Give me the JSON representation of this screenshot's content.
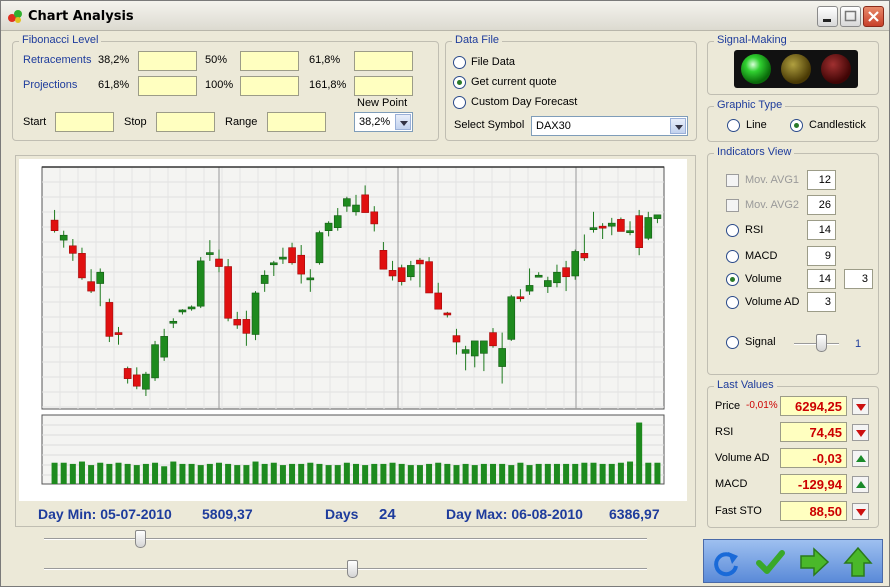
{
  "window": {
    "title": "Chart Analysis"
  },
  "fibonacci": {
    "legend": "Fibonacci Level",
    "retracements_label": "Retracements",
    "retracements": [
      "38,2%",
      "50%",
      "61,8%"
    ],
    "projections_label": "Projections",
    "projections": [
      "61,8%",
      "100%",
      "161,8%"
    ],
    "new_point_label": "New Point",
    "new_point_value": "38,2%",
    "start_label": "Start",
    "stop_label": "Stop",
    "range_label": "Range"
  },
  "datafile": {
    "legend": "Data File",
    "options": [
      "File Data",
      "Get current quote",
      "Custom Day Forecast"
    ],
    "selected": 1,
    "symbol_label": "Select Symbol",
    "symbol_value": "DAX30"
  },
  "signal_making": {
    "legend": "Signal-Making",
    "lights": [
      "#2ec82e",
      "#8a7a10",
      "#7a1010"
    ]
  },
  "graphic_type": {
    "legend": "Graphic Type",
    "options": [
      "Line",
      "Candlestick"
    ],
    "selected": 1
  },
  "indicators": {
    "legend": "Indicators View",
    "mov_avg1_label": "Mov. AVG1",
    "mov_avg1_value": "12",
    "mov_avg2_label": "Mov. AVG2",
    "mov_avg2_value": "26",
    "rsi_label": "RSI",
    "rsi_value": "14",
    "macd_label": "MACD",
    "macd_value": "9",
    "volume_label": "Volume",
    "volume_value": "14",
    "volume_value2": "3",
    "volume_ad_label": "Volume AD",
    "volume_ad_value": "3",
    "signal_label": "Signal",
    "signal_value": "1",
    "signal_level": 0.6
  },
  "last_values": {
    "legend": "Last Values",
    "price_label": "Price",
    "price_change": "-0,01%",
    "price_value": "6294,25",
    "rsi_label": "RSI",
    "rsi_value": "74,45",
    "volume_ad_label": "Volume AD",
    "volume_ad_value": "-0,03",
    "macd_label": "MACD",
    "macd_value": "-129,94",
    "fast_sto_label": "Fast STO",
    "fast_sto_value": "88,50"
  },
  "chart_info": {
    "day_min_label": "Day Min: 05-07-2010",
    "day_min_value": "5809,37",
    "days_label": "Days",
    "days_value": "24",
    "day_max_label": "Day Max: 06-08-2010",
    "day_max_value": "6386,97"
  },
  "sliders": {
    "top_level": 0.16,
    "bottom_level": 0.51
  },
  "chart_data": {
    "type": "candlestick",
    "ylim": [
      5809.37,
      6386.97
    ],
    "grid": true,
    "up_color": "#1e8a1e",
    "down_color": "#e01010",
    "candles": [
      {
        "o": 6278,
        "h": 6305,
        "l": 6245,
        "c": 6250
      },
      {
        "o": 6225,
        "h": 6250,
        "l": 6205,
        "c": 6238
      },
      {
        "o": 6210,
        "h": 6228,
        "l": 6170,
        "c": 6190
      },
      {
        "o": 6190,
        "h": 6205,
        "l": 6120,
        "c": 6125
      },
      {
        "o": 6115,
        "h": 6148,
        "l": 6085,
        "c": 6090
      },
      {
        "o": 6110,
        "h": 6150,
        "l": 6050,
        "c": 6140
      },
      {
        "o": 6060,
        "h": 6070,
        "l": 5955,
        "c": 5970
      },
      {
        "o": 5980,
        "h": 5995,
        "l": 5948,
        "c": 5978
      },
      {
        "o": 5885,
        "h": 5890,
        "l": 5845,
        "c": 5858
      },
      {
        "o": 5868,
        "h": 5888,
        "l": 5830,
        "c": 5838
      },
      {
        "o": 5830,
        "h": 5876,
        "l": 5812,
        "c": 5870
      },
      {
        "o": 5860,
        "h": 5958,
        "l": 5852,
        "c": 5948
      },
      {
        "o": 5915,
        "h": 5990,
        "l": 5905,
        "c": 5970
      },
      {
        "o": 6005,
        "h": 6018,
        "l": 5992,
        "c": 6010
      },
      {
        "o": 6040,
        "h": 6042,
        "l": 6028,
        "c": 6040
      },
      {
        "o": 6045,
        "h": 6052,
        "l": 6038,
        "c": 6048
      },
      {
        "o": 6050,
        "h": 6180,
        "l": 6045,
        "c": 6170
      },
      {
        "o": 6190,
        "h": 6225,
        "l": 6170,
        "c": 6192
      },
      {
        "o": 6175,
        "h": 6200,
        "l": 6140,
        "c": 6155
      },
      {
        "o": 6155,
        "h": 6175,
        "l": 6010,
        "c": 6018
      },
      {
        "o": 6015,
        "h": 6035,
        "l": 5990,
        "c": 6000
      },
      {
        "o": 6015,
        "h": 6038,
        "l": 5945,
        "c": 5978
      },
      {
        "o": 5975,
        "h": 6090,
        "l": 5960,
        "c": 6085
      },
      {
        "o": 6110,
        "h": 6145,
        "l": 6088,
        "c": 6132
      },
      {
        "o": 6160,
        "h": 6170,
        "l": 6130,
        "c": 6165
      },
      {
        "o": 6180,
        "h": 6205,
        "l": 6162,
        "c": 6180
      },
      {
        "o": 6205,
        "h": 6218,
        "l": 6160,
        "c": 6165
      },
      {
        "o": 6185,
        "h": 6212,
        "l": 6110,
        "c": 6135
      },
      {
        "o": 6120,
        "h": 6148,
        "l": 6088,
        "c": 6125
      },
      {
        "o": 6165,
        "h": 6250,
        "l": 6160,
        "c": 6245
      },
      {
        "o": 6250,
        "h": 6275,
        "l": 6235,
        "c": 6270
      },
      {
        "o": 6258,
        "h": 6310,
        "l": 6250,
        "c": 6290
      },
      {
        "o": 6315,
        "h": 6340,
        "l": 6300,
        "c": 6335
      },
      {
        "o": 6300,
        "h": 6345,
        "l": 6290,
        "c": 6318
      },
      {
        "o": 6345,
        "h": 6370,
        "l": 6300,
        "c": 6298
      },
      {
        "o": 6300,
        "h": 6315,
        "l": 6248,
        "c": 6268
      },
      {
        "o": 6198,
        "h": 6220,
        "l": 6150,
        "c": 6148
      },
      {
        "o": 6145,
        "h": 6170,
        "l": 6118,
        "c": 6130
      },
      {
        "o": 6152,
        "h": 6160,
        "l": 6105,
        "c": 6115
      },
      {
        "o": 6128,
        "h": 6170,
        "l": 6118,
        "c": 6158
      },
      {
        "o": 6172,
        "h": 6178,
        "l": 6100,
        "c": 6162
      },
      {
        "o": 6168,
        "h": 6180,
        "l": 6085,
        "c": 6085
      },
      {
        "o": 6085,
        "h": 6112,
        "l": 6058,
        "c": 6042
      },
      {
        "o": 6032,
        "h": 6035,
        "l": 6020,
        "c": 6030
      },
      {
        "o": 5972,
        "h": 5990,
        "l": 5922,
        "c": 5955
      },
      {
        "o": 5925,
        "h": 5945,
        "l": 5880,
        "c": 5935
      },
      {
        "o": 5918,
        "h": 5950,
        "l": 5888,
        "c": 5958
      },
      {
        "o": 5925,
        "h": 5935,
        "l": 5878,
        "c": 5958
      },
      {
        "o": 5980,
        "h": 5992,
        "l": 5940,
        "c": 5945
      },
      {
        "o": 5890,
        "h": 5980,
        "l": 5845,
        "c": 5938
      },
      {
        "o": 5962,
        "h": 6080,
        "l": 5958,
        "c": 6075
      },
      {
        "o": 6075,
        "h": 6095,
        "l": 6062,
        "c": 6070
      },
      {
        "o": 6090,
        "h": 6150,
        "l": 6080,
        "c": 6105
      },
      {
        "o": 6132,
        "h": 6140,
        "l": 6130,
        "c": 6132
      },
      {
        "o": 6102,
        "h": 6128,
        "l": 6085,
        "c": 6118
      },
      {
        "o": 6112,
        "h": 6160,
        "l": 6100,
        "c": 6140
      },
      {
        "o": 6152,
        "h": 6170,
        "l": 6090,
        "c": 6128
      },
      {
        "o": 6130,
        "h": 6200,
        "l": 6120,
        "c": 6195
      },
      {
        "o": 6190,
        "h": 6240,
        "l": 6170,
        "c": 6178
      },
      {
        "o": 6258,
        "h": 6300,
        "l": 6245,
        "c": 6258
      },
      {
        "o": 6262,
        "h": 6270,
        "l": 6228,
        "c": 6260
      },
      {
        "o": 6262,
        "h": 6284,
        "l": 6238,
        "c": 6270
      },
      {
        "o": 6280,
        "h": 6285,
        "l": 6265,
        "c": 6248
      },
      {
        "o": 6248,
        "h": 6275,
        "l": 6238,
        "c": 6250
      },
      {
        "o": 6290,
        "h": 6305,
        "l": 6185,
        "c": 6205
      },
      {
        "o": 6230,
        "h": 6300,
        "l": 6225,
        "c": 6285
      },
      {
        "o": 6282,
        "h": 6290,
        "l": 6270,
        "c": 6292
      }
    ],
    "volume": [
      18,
      18,
      17,
      19,
      16,
      18,
      17,
      18,
      17,
      16,
      17,
      18,
      15,
      19,
      17,
      17,
      16,
      17,
      18,
      17,
      16,
      16,
      19,
      17,
      18,
      16,
      17,
      17,
      18,
      17,
      16,
      16,
      18,
      17,
      16,
      17,
      17,
      18,
      17,
      16,
      16,
      17,
      18,
      17,
      16,
      17,
      16,
      17,
      17,
      17,
      16,
      18,
      16,
      17,
      17,
      17,
      17,
      17,
      18,
      18,
      17,
      17,
      18,
      19,
      52,
      18,
      18
    ]
  }
}
